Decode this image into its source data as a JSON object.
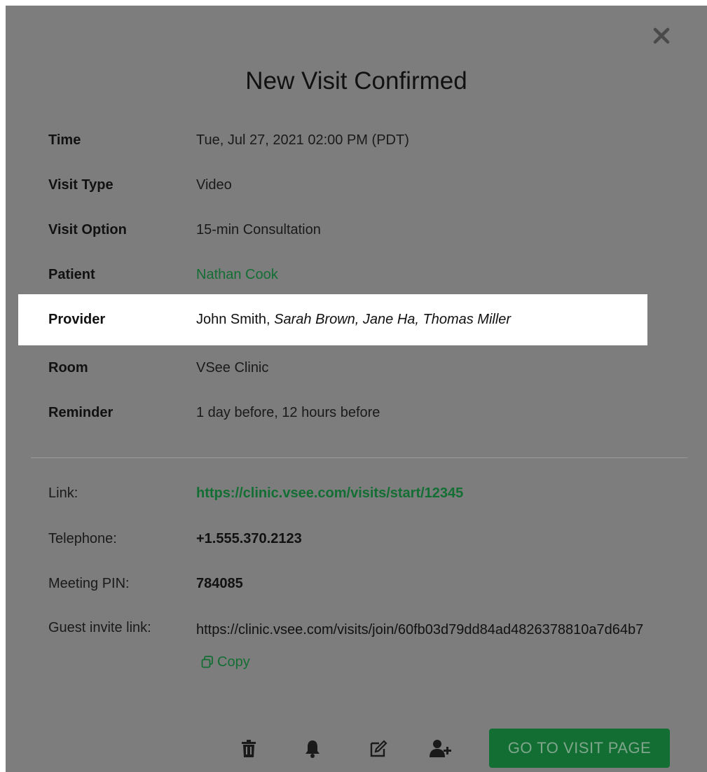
{
  "dialog": {
    "title": "New Visit Confirmed",
    "close_icon": "close-icon"
  },
  "details": {
    "time": {
      "label": "Time",
      "value": "Tue, Jul 27, 2021 02:00 PM (PDT)"
    },
    "visit_type": {
      "label": "Visit Type",
      "value": "Video"
    },
    "visit_option": {
      "label": "Visit Option",
      "value": "15-min Consultation"
    },
    "patient": {
      "label": "Patient",
      "value": "Nathan Cook"
    },
    "provider": {
      "label": "Provider",
      "primary": "John Smith,",
      "others": "Sarah Brown, Jane Ha, Thomas Miller"
    },
    "room": {
      "label": "Room",
      "value": "VSee Clinic"
    },
    "reminder": {
      "label": "Reminder",
      "value": "1 day before, 12 hours before"
    }
  },
  "info": {
    "link": {
      "label": "Link:",
      "value": "https://clinic.vsee.com/visits/start/12345"
    },
    "telephone": {
      "label": "Telephone:",
      "value": "+1.555.370.2123"
    },
    "meeting_pin": {
      "label": "Meeting PIN:",
      "value": "784085"
    },
    "guest_invite": {
      "label": "Guest invite link:",
      "value": "https://clinic.vsee.com/visits/join/60fb03d79dd84ad4826378810a7d64b7",
      "copy_label": "Copy"
    }
  },
  "footer": {
    "icons": [
      "trash-icon",
      "bell-icon",
      "edit-icon",
      "add-user-icon"
    ],
    "go_button_label": "GO TO VISIT PAGE"
  },
  "colors": {
    "overlay": "#7d7d7d",
    "accent_green": "#136e34",
    "highlight": "#ffffff"
  }
}
